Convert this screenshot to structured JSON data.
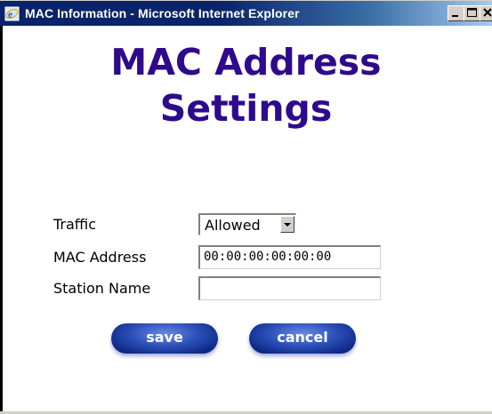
{
  "window": {
    "title": "MAC Information - Microsoft Internet Explorer",
    "icon": "ie-icon",
    "controls": [
      "minimize-icon",
      "maximize-icon",
      "close-icon"
    ]
  },
  "heading": {
    "line1": "MAC Address",
    "line2": "Settings",
    "color": "#2e0a8c"
  },
  "form": {
    "traffic": {
      "label": "Traffic",
      "selected": "Allowed"
    },
    "mac_address": {
      "label": "MAC Address",
      "value": "00:00:00:00:00:00"
    },
    "station_name": {
      "label": "Station Name",
      "value": ""
    }
  },
  "buttons": {
    "save_label": "save",
    "cancel_label": "cancel",
    "color": "#1d3fa8"
  }
}
